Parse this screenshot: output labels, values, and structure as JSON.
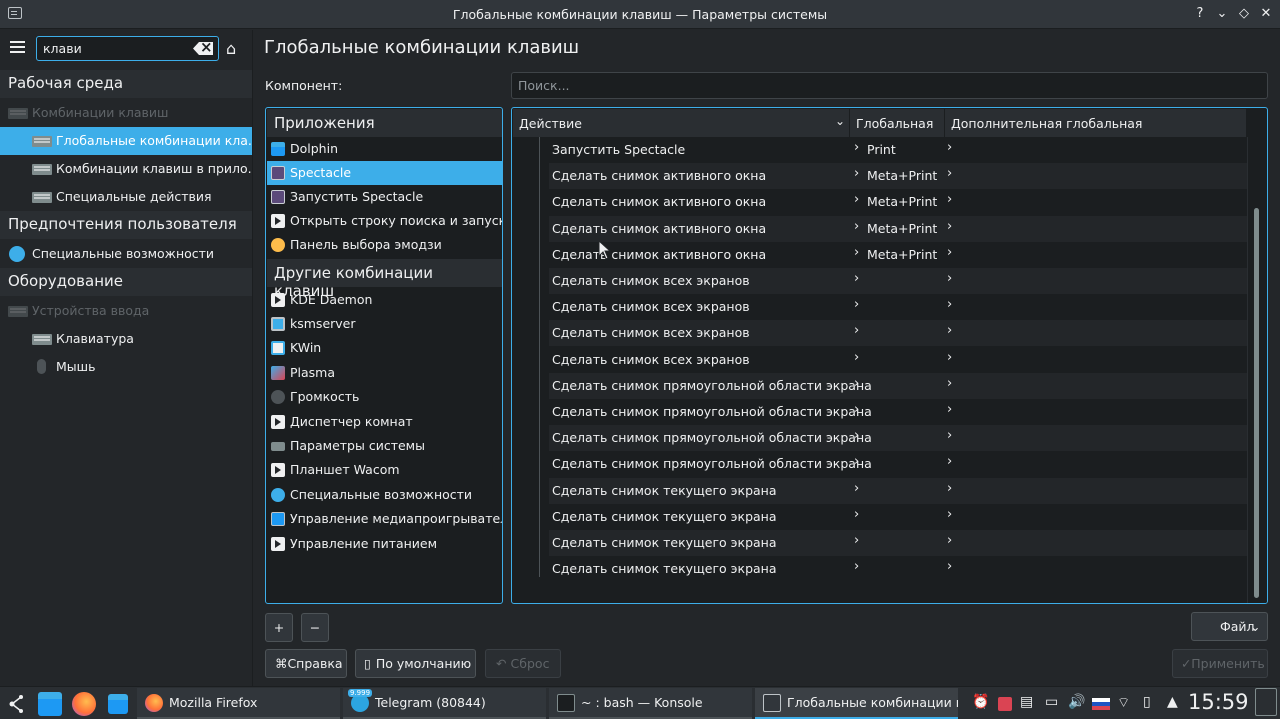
{
  "window": {
    "title": "Глобальные комбинации клавиш — Параметры системы",
    "help": "?",
    "minimize": "⌄",
    "keep_above": "◇",
    "close": "✕"
  },
  "sidebar": {
    "search_value": "клави",
    "sections": [
      {
        "label": "Рабочая среда"
      },
      {
        "label": "Предпочтения пользователя"
      },
      {
        "label": "Оборудование"
      }
    ],
    "items": [
      {
        "label": "Комбинации клавиш"
      },
      {
        "label": "Глобальные комбинации кла..."
      },
      {
        "label": "Комбинации клавиш в прило..."
      },
      {
        "label": "Специальные действия"
      },
      {
        "label": "Специальные возможности"
      },
      {
        "label": "Устройства ввода"
      },
      {
        "label": "Клавиатура"
      },
      {
        "label": "Мышь"
      }
    ]
  },
  "main": {
    "title": "Глобальные комбинации клавиш",
    "component_label": "Компонент:",
    "filter_placeholder": "Поиск...",
    "apps_section": "Приложения",
    "apps": [
      "Dolphin",
      "Spectacle",
      "Запустить Spectacle",
      "Открыть строку поиска и запуска...",
      "Панель выбора эмодзи"
    ],
    "other_section": "Другие комбинации клавиш",
    "other": [
      "KDE Daemon",
      "ksmserver",
      "KWin",
      "Plasma",
      "Громкость",
      "Диспетчер комнат",
      "Параметры системы",
      "Планшет Wacom",
      "Специальные возможности",
      "Управление медиапроигрывател...",
      "Управление питанием"
    ]
  },
  "table": {
    "headers": [
      "Действие",
      "Глобальная",
      "Дополнительная глобальная"
    ],
    "rows": [
      {
        "action": "Запустить Spectacle",
        "global": "Print"
      },
      {
        "action": "Сделать снимок активного окна",
        "global": "Meta+Print"
      },
      {
        "action": "Сделать снимок активного окна",
        "global": "Meta+Print"
      },
      {
        "action": "Сделать снимок активного окна",
        "global": "Meta+Print"
      },
      {
        "action": "Сделать снимок активного окна",
        "global": "Meta+Print"
      },
      {
        "action": "Сделать снимок всех экранов",
        "global": ""
      },
      {
        "action": "Сделать снимок всех экранов",
        "global": ""
      },
      {
        "action": "Сделать снимок всех экранов",
        "global": ""
      },
      {
        "action": "Сделать снимок всех экранов",
        "global": ""
      },
      {
        "action": "Сделать снимок прямоугольной области экрана",
        "global": ""
      },
      {
        "action": "Сделать снимок прямоугольной области экрана",
        "global": ""
      },
      {
        "action": "Сделать снимок прямоугольной области экрана",
        "global": ""
      },
      {
        "action": "Сделать снимок прямоугольной области экрана",
        "global": ""
      },
      {
        "action": "Сделать снимок текущего экрана",
        "global": ""
      },
      {
        "action": "Сделать снимок текущего экрана",
        "global": ""
      },
      {
        "action": "Сделать снимок текущего экрана",
        "global": ""
      },
      {
        "action": "Сделать снимок текущего экрана",
        "global": ""
      }
    ]
  },
  "buttons": {
    "add": "+",
    "remove": "−",
    "file": "Файл",
    "help": "Справка",
    "defaults": "По умолчанию",
    "reset": "Сброс",
    "apply": "Применить"
  },
  "taskbar": {
    "tasks": [
      {
        "label": "Mozilla Firefox"
      },
      {
        "label": "Telegram (80844)"
      },
      {
        "label": "~ : bash — Konsole"
      },
      {
        "label": "Глобальные комбинации к..."
      }
    ],
    "telegram_badge": "9.999",
    "clock": "15:59"
  },
  "colors": {
    "accent": "#3daee9",
    "background": "#232629",
    "panel": "#2a2e32"
  }
}
